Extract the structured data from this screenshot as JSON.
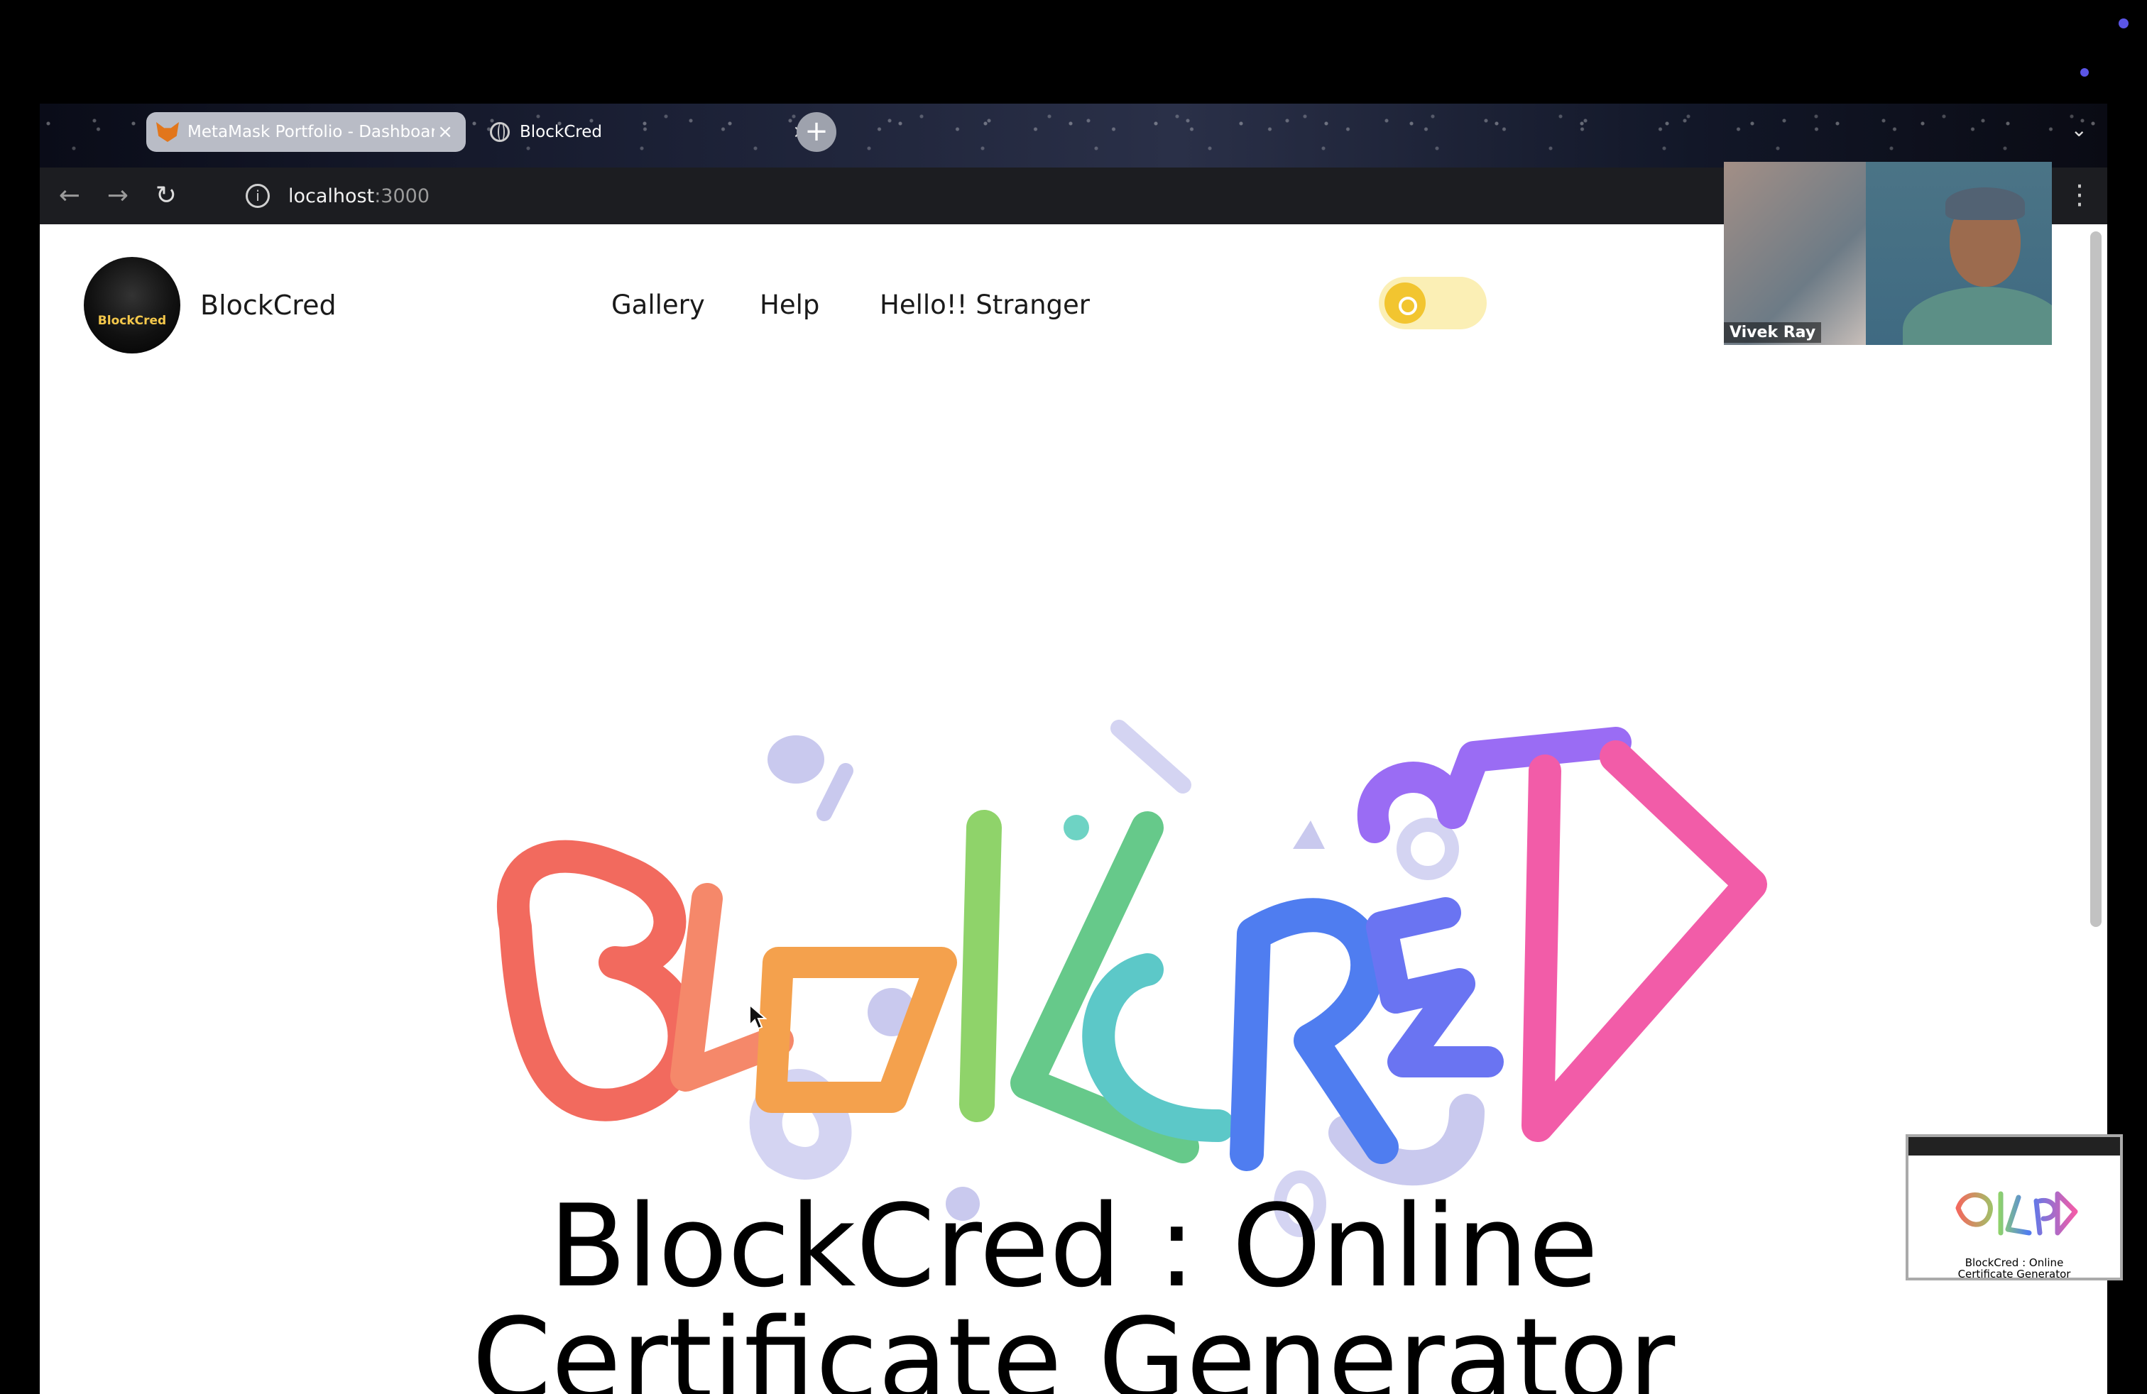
{
  "browser": {
    "tabs": [
      {
        "label": "MetaMask Portfolio - Dashboard",
        "icon": "metamask-fox-icon",
        "active": true
      },
      {
        "label": "BlockCred",
        "icon": "globe-icon",
        "active": false
      }
    ],
    "url_host": "localhost",
    "url_port": ":3000"
  },
  "site": {
    "brand": "BlockCred",
    "logo_text": "BlockCred",
    "nav": [
      "Gallery",
      "Help",
      "Hello!! Stranger"
    ],
    "hero_art_letters": [
      "B",
      "L",
      "O",
      "C",
      "K",
      "C",
      "R",
      "E",
      "D"
    ],
    "hero_title_line1": "BlockCred : Online",
    "hero_title_line2": "Certificate Generator"
  },
  "video_call": {
    "participant_name": "Vivek Ray"
  },
  "preview_thumbnail": {
    "title_line1": "BlockCred : Online",
    "title_line2": "Certificate Generator"
  },
  "colors": {
    "accent_yellow": "#f2c530",
    "art_gradient": [
      "#f26a5e",
      "#f4a14d",
      "#8fd36a",
      "#5cc8c8",
      "#4f7df0",
      "#8c6cf4",
      "#f25ca8"
    ]
  }
}
